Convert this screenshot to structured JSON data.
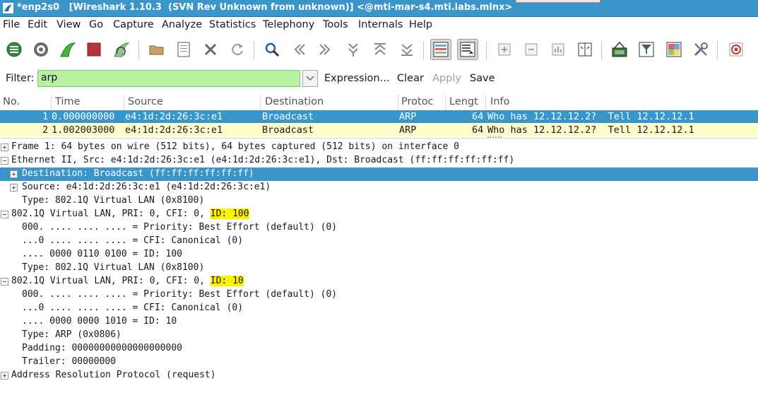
{
  "window": {
    "title": "*enp2s0   [Wireshark 1.10.3  (SVN Rev Unknown from unknown)] <@mti-mar-s4.mti.labs.mlnx>"
  },
  "menu": [
    "File",
    "Edit",
    "View",
    "Go",
    "Capture",
    "Analyze",
    "Statistics",
    "Telephony",
    "Tools",
    "Internals",
    "Help"
  ],
  "toolbar": {
    "icons": [
      "interfaces-icon",
      "options-icon",
      "start-capture-icon",
      "stop-capture-icon",
      "restart-capture-icon",
      "open-file-icon",
      "save-file-icon",
      "close-file-icon",
      "reload-icon",
      "find-icon",
      "go-back-icon",
      "go-forward-icon",
      "go-to-packet-icon",
      "go-first-icon",
      "go-last-icon",
      "colorize-icon",
      "auto-scroll-icon",
      "zoom-in-icon",
      "zoom-out-icon",
      "normal-size-icon",
      "resize-columns-icon",
      "capture-filters-icon",
      "display-filters-icon",
      "coloring-rules-icon",
      "preferences-icon",
      "help-icon"
    ]
  },
  "filter": {
    "label": "Filter:",
    "value": "arp",
    "expression": "Expression...",
    "clear": "Clear",
    "apply": "Apply",
    "save": "Save"
  },
  "packet_list": {
    "columns": [
      "No.",
      "Time",
      "Source",
      "Destination",
      "Protoc",
      "Lengt",
      "Info"
    ],
    "rows": [
      {
        "no": "1",
        "time": "0.000000000",
        "source": "e4:1d:2d:26:3c:e1",
        "destination": "Broadcast",
        "protocol": "ARP",
        "length": "64",
        "info": "Who has 12.12.12.2?  Tell 12.12.12.1"
      },
      {
        "no": "2",
        "time": "1.002003000",
        "source": "e4:1d:2d:26:3c:e1",
        "destination": "Broadcast",
        "protocol": "ARP",
        "length": "64",
        "info": "Who has 12.12.12.2?  Tell 12.12.12.1"
      }
    ]
  },
  "details": {
    "frame": "Frame 1: 64 bytes on wire (512 bits), 64 bytes captured (512 bits) on interface 0",
    "ethernet": "Ethernet II, Src: e4:1d:2d:26:3c:e1 (e4:1d:2d:26:3c:e1), Dst: Broadcast (ff:ff:ff:ff:ff:ff)",
    "eth_dst": "Destination: Broadcast (ff:ff:ff:ff:ff:ff)",
    "eth_src": "Source: e4:1d:2d:26:3c:e1 (e4:1d:2d:26:3c:e1)",
    "eth_type": "Type: 802.1Q Virtual LAN (0x8100)",
    "vlan1_prefix": "802.1Q Virtual LAN, PRI: 0, CFI: 0, ",
    "vlan1_id": "ID: 100",
    "vlan1_pri": "000. .... .... .... = Priority: Best Effort (default) (0)",
    "vlan1_cfi": "...0 .... .... .... = CFI: Canonical (0)",
    "vlan1_idbits": ".... 0000 0110 0100 = ID: 100",
    "vlan1_type": "Type: 802.1Q Virtual LAN (0x8100)",
    "vlan2_prefix": "802.1Q Virtual LAN, PRI: 0, CFI: 0, ",
    "vlan2_id": "ID: 10",
    "vlan2_pri": "000. .... .... .... = Priority: Best Effort (default) (0)",
    "vlan2_cfi": "...0 .... .... .... = CFI: Canonical (0)",
    "vlan2_idbits": ".... 0000 0000 1010 = ID: 10",
    "vlan2_type": "Type: ARP (0x0806)",
    "padding": "Padding: 00000000000000000000",
    "trailer": "Trailer: 00000000",
    "arp": "Address Resolution Protocol (request)"
  },
  "colors": {
    "selection": "#3a95c9",
    "row_normal": "#fefecd",
    "filter_valid": "#b6f2a2",
    "highlight": "#fff200"
  }
}
